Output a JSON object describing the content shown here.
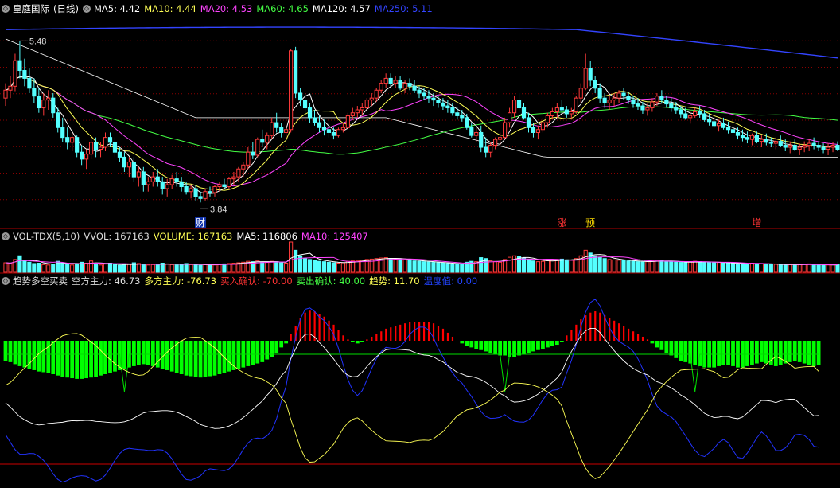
{
  "colors": {
    "up": "#ff3b3b",
    "down": "#54ffff",
    "ma5": "#ffffff",
    "ma10": "#ffff55",
    "ma20": "#ff44ff",
    "ma60": "#44ff44",
    "ma120": "#ffffff",
    "ma250": "#3344ff",
    "grid": "#8b0000",
    "green_bar": "#00ff00",
    "red_bar": "#ff0000",
    "blue_line": "#2233ff",
    "yellow_line": "#ffff55"
  },
  "main": {
    "stock_name": "皇庭国际",
    "period": "(日线)",
    "indicators": [
      {
        "label": "MA5: 4.42",
        "color": "#ffffff"
      },
      {
        "label": "MA10: 4.44",
        "color": "#ffff55"
      },
      {
        "label": "MA20: 4.53",
        "color": "#ff44ff"
      },
      {
        "label": "MA60: 4.65",
        "color": "#44ff44"
      },
      {
        "label": "MA120: 4.57",
        "color": "#ffffff"
      },
      {
        "label": "MA250: 5.11",
        "color": "#3344ff"
      }
    ],
    "high_label": "5.48",
    "low_label": "3.84",
    "event_marks": [
      {
        "text": "财",
        "index": 41,
        "color": "#ffffff",
        "bg": "#1133aa"
      },
      {
        "text": "涨",
        "index": 117,
        "color": "#ff3333",
        "bg": ""
      },
      {
        "text": "预",
        "index": 123,
        "color": "#ffdd00",
        "bg": ""
      },
      {
        "text": "增",
        "index": 158,
        "color": "#ff3333",
        "bg": ""
      }
    ]
  },
  "volume": {
    "title": "VOL-TDX(5,10)",
    "indicators": [
      {
        "label": "VVOL: 167163",
        "color": "#dddddd"
      },
      {
        "label": "VOLUME: 167163",
        "color": "#ffff55"
      },
      {
        "label": "MA5: 116806",
        "color": "#ffffff"
      },
      {
        "label": "MA10: 125407",
        "color": "#ff44ff"
      }
    ]
  },
  "trend": {
    "title": "趋势多空买卖",
    "indicators": [
      {
        "label": "空方主力: 46.73",
        "color": "#dddddd"
      },
      {
        "label": "多方主力: -76.73",
        "color": "#ffff55"
      },
      {
        "label": "买入确认: -70.00",
        "color": "#ff3333"
      },
      {
        "label": "卖出确认: 40.00",
        "color": "#44ff44"
      },
      {
        "label": "趋势: 11.70",
        "color": "#ffff55"
      },
      {
        "label": "温度值: 0.00",
        "color": "#2244ff"
      }
    ]
  },
  "chart_data": {
    "type": "candlestick",
    "series_count": 176,
    "price_range": [
      3.6,
      5.75
    ],
    "candles_ohlc": [
      [
        4.9,
        5.05,
        4.82,
        4.98
      ],
      [
        4.98,
        5.12,
        4.9,
        5.02
      ],
      [
        5.02,
        5.35,
        4.97,
        5.28
      ],
      [
        5.28,
        5.48,
        5.1,
        5.18
      ],
      [
        5.18,
        5.3,
        5.02,
        5.1
      ],
      [
        5.1,
        5.2,
        4.95,
        5.0
      ],
      [
        5.0,
        5.1,
        4.85,
        4.92
      ],
      [
        4.92,
        5.0,
        4.75,
        4.8
      ],
      [
        4.8,
        4.95,
        4.72,
        4.88
      ],
      [
        4.88,
        4.98,
        4.78,
        4.9
      ],
      [
        4.9,
        4.95,
        4.7,
        4.75
      ],
      [
        4.75,
        4.8,
        4.55,
        4.6
      ],
      [
        4.6,
        4.7,
        4.45,
        4.5
      ],
      [
        4.5,
        4.6,
        4.38,
        4.45
      ],
      [
        4.45,
        4.55,
        4.36,
        4.5
      ],
      [
        4.5,
        4.52,
        4.3,
        4.35
      ],
      [
        4.35,
        4.42,
        4.22,
        4.28
      ],
      [
        4.28,
        4.38,
        4.18,
        4.33
      ],
      [
        4.33,
        4.5,
        4.28,
        4.45
      ],
      [
        4.45,
        4.5,
        4.3,
        4.38
      ],
      [
        4.38,
        4.45,
        4.3,
        4.4
      ],
      [
        4.4,
        4.55,
        4.36,
        4.5
      ],
      [
        4.5,
        4.55,
        4.4,
        4.45
      ],
      [
        4.45,
        4.5,
        4.3,
        4.35
      ],
      [
        4.35,
        4.4,
        4.25,
        4.3
      ],
      [
        4.3,
        4.35,
        4.15,
        4.2
      ],
      [
        4.2,
        4.3,
        4.1,
        4.25
      ],
      [
        4.25,
        4.3,
        4.05,
        4.1
      ],
      [
        4.1,
        4.2,
        4.0,
        4.15
      ],
      [
        4.15,
        4.2,
        3.95,
        4.02
      ],
      [
        4.02,
        4.1,
        3.95,
        4.05
      ],
      [
        4.05,
        4.15,
        4.0,
        4.1
      ],
      [
        4.1,
        4.18,
        4.0,
        4.05
      ],
      [
        4.05,
        4.1,
        3.92,
        3.98
      ],
      [
        3.98,
        4.08,
        3.9,
        4.02
      ],
      [
        4.02,
        4.12,
        3.98,
        4.08
      ],
      [
        4.08,
        4.15,
        4.0,
        4.05
      ],
      [
        4.05,
        4.1,
        3.95,
        4.0
      ],
      [
        4.0,
        4.05,
        3.92,
        3.95
      ],
      [
        3.95,
        4.02,
        3.88,
        3.98
      ],
      [
        3.98,
        4.02,
        3.86,
        3.9
      ],
      [
        3.9,
        3.95,
        3.84,
        3.88
      ],
      [
        3.88,
        3.98,
        3.86,
        3.95
      ],
      [
        3.95,
        4.0,
        3.9,
        3.94
      ],
      [
        3.94,
        4.02,
        3.9,
        4.0
      ],
      [
        4.0,
        4.05,
        3.95,
        4.02
      ],
      [
        4.02,
        4.08,
        3.98,
        4.0
      ],
      [
        4.0,
        4.1,
        3.98,
        4.08
      ],
      [
        4.08,
        4.15,
        4.02,
        4.1
      ],
      [
        4.1,
        4.2,
        4.05,
        4.18
      ],
      [
        4.18,
        4.25,
        4.1,
        4.22
      ],
      [
        4.22,
        4.4,
        4.18,
        4.35
      ],
      [
        4.35,
        4.45,
        4.28,
        4.32
      ],
      [
        4.32,
        4.5,
        4.3,
        4.48
      ],
      [
        4.48,
        4.58,
        4.4,
        4.45
      ],
      [
        4.45,
        4.55,
        4.38,
        4.52
      ],
      [
        4.52,
        4.7,
        4.48,
        4.65
      ],
      [
        4.65,
        4.75,
        4.55,
        4.6
      ],
      [
        4.6,
        4.65,
        4.5,
        4.55
      ],
      [
        4.55,
        4.62,
        4.5,
        4.58
      ],
      [
        4.58,
        5.4,
        4.55,
        5.38
      ],
      [
        5.38,
        5.42,
        4.9,
        4.95
      ],
      [
        4.95,
        5.0,
        4.82,
        4.88
      ],
      [
        4.88,
        4.95,
        4.75,
        4.8
      ],
      [
        4.8,
        4.85,
        4.65,
        4.7
      ],
      [
        4.7,
        4.78,
        4.62,
        4.65
      ],
      [
        4.65,
        4.72,
        4.55,
        4.6
      ],
      [
        4.6,
        4.68,
        4.52,
        4.58
      ],
      [
        4.58,
        4.65,
        4.5,
        4.55
      ],
      [
        4.55,
        4.6,
        4.48,
        4.52
      ],
      [
        4.52,
        4.6,
        4.5,
        4.58
      ],
      [
        4.58,
        4.65,
        4.55,
        4.6
      ],
      [
        4.6,
        4.75,
        4.58,
        4.72
      ],
      [
        4.72,
        4.8,
        4.68,
        4.75
      ],
      [
        4.75,
        4.82,
        4.7,
        4.78
      ],
      [
        4.78,
        4.85,
        4.72,
        4.8
      ],
      [
        4.8,
        4.9,
        4.78,
        4.88
      ],
      [
        4.88,
        4.95,
        4.82,
        4.9
      ],
      [
        4.9,
        5.0,
        4.86,
        4.98
      ],
      [
        4.98,
        5.08,
        4.95,
        5.05
      ],
      [
        5.05,
        5.15,
        5.0,
        5.1
      ],
      [
        5.1,
        5.15,
        5.02,
        5.05
      ],
      [
        5.05,
        5.12,
        5.0,
        5.08
      ],
      [
        5.08,
        5.12,
        4.98,
        5.0
      ],
      [
        5.0,
        5.08,
        4.95,
        5.05
      ],
      [
        5.05,
        5.1,
        4.98,
        5.02
      ],
      [
        5.02,
        5.08,
        4.95,
        4.98
      ],
      [
        4.98,
        5.02,
        4.9,
        4.95
      ],
      [
        4.95,
        5.0,
        4.88,
        4.92
      ],
      [
        4.92,
        4.98,
        4.85,
        4.9
      ],
      [
        4.9,
        4.95,
        4.82,
        4.88
      ],
      [
        4.88,
        4.92,
        4.8,
        4.85
      ],
      [
        4.85,
        4.9,
        4.78,
        4.82
      ],
      [
        4.82,
        4.88,
        4.75,
        4.8
      ],
      [
        4.8,
        4.85,
        4.72,
        4.75
      ],
      [
        4.75,
        4.8,
        4.68,
        4.72
      ],
      [
        4.72,
        4.78,
        4.66,
        4.7
      ],
      [
        4.7,
        4.74,
        4.58,
        4.6
      ],
      [
        4.6,
        4.65,
        4.5,
        4.52
      ],
      [
        4.52,
        4.6,
        4.45,
        4.55
      ],
      [
        4.55,
        4.62,
        4.35,
        4.4
      ],
      [
        4.4,
        4.5,
        4.3,
        4.35
      ],
      [
        4.35,
        4.45,
        4.3,
        4.42
      ],
      [
        4.42,
        4.5,
        4.38,
        4.48
      ],
      [
        4.48,
        4.55,
        4.42,
        4.5
      ],
      [
        4.5,
        4.7,
        4.48,
        4.65
      ],
      [
        4.65,
        4.8,
        4.6,
        4.75
      ],
      [
        4.75,
        4.92,
        4.7,
        4.88
      ],
      [
        4.88,
        4.95,
        4.75,
        4.8
      ],
      [
        4.8,
        4.85,
        4.68,
        4.7
      ],
      [
        4.7,
        4.75,
        4.55,
        4.6
      ],
      [
        4.6,
        4.65,
        4.5,
        4.55
      ],
      [
        4.55,
        4.62,
        4.48,
        4.58
      ],
      [
        4.58,
        4.7,
        4.55,
        4.65
      ],
      [
        4.65,
        4.75,
        4.6,
        4.72
      ],
      [
        4.72,
        4.8,
        4.68,
        4.76
      ],
      [
        4.76,
        4.85,
        4.7,
        4.8
      ],
      [
        4.8,
        4.88,
        4.74,
        4.78
      ],
      [
        4.78,
        4.82,
        4.7,
        4.74
      ],
      [
        4.74,
        4.8,
        4.68,
        4.76
      ],
      [
        4.76,
        4.92,
        4.74,
        4.9
      ],
      [
        4.9,
        5.05,
        4.85,
        5.0
      ],
      [
        5.0,
        5.35,
        4.98,
        5.2
      ],
      [
        5.2,
        5.28,
        5.02,
        5.08
      ],
      [
        5.08,
        5.12,
        4.95,
        5.0
      ],
      [
        5.0,
        5.05,
        4.85,
        4.9
      ],
      [
        4.9,
        4.95,
        4.8,
        4.85
      ],
      [
        4.85,
        4.92,
        4.78,
        4.88
      ],
      [
        4.88,
        4.95,
        4.82,
        4.9
      ],
      [
        4.9,
        4.98,
        4.85,
        4.95
      ],
      [
        4.95,
        5.0,
        4.88,
        4.92
      ],
      [
        4.92,
        4.96,
        4.84,
        4.88
      ],
      [
        4.88,
        4.92,
        4.8,
        4.84
      ],
      [
        4.84,
        4.9,
        4.78,
        4.82
      ],
      [
        4.82,
        4.86,
        4.74,
        4.78
      ],
      [
        4.78,
        4.84,
        4.72,
        4.8
      ],
      [
        4.8,
        4.9,
        4.76,
        4.86
      ],
      [
        4.86,
        4.95,
        4.82,
        4.92
      ],
      [
        4.92,
        4.98,
        4.85,
        4.88
      ],
      [
        4.88,
        4.92,
        4.8,
        4.84
      ],
      [
        4.84,
        4.9,
        4.76,
        4.8
      ],
      [
        4.8,
        4.86,
        4.74,
        4.78
      ],
      [
        4.78,
        4.82,
        4.7,
        4.74
      ],
      [
        4.74,
        4.8,
        4.68,
        4.7
      ],
      [
        4.7,
        4.76,
        4.64,
        4.72
      ],
      [
        4.72,
        4.8,
        4.7,
        4.76
      ],
      [
        4.76,
        4.82,
        4.7,
        4.74
      ],
      [
        4.74,
        4.78,
        4.66,
        4.68
      ],
      [
        4.68,
        4.74,
        4.62,
        4.66
      ],
      [
        4.66,
        4.7,
        4.6,
        4.62
      ],
      [
        4.62,
        4.68,
        4.56,
        4.64
      ],
      [
        4.64,
        4.7,
        4.58,
        4.6
      ],
      [
        4.6,
        4.66,
        4.54,
        4.58
      ],
      [
        4.58,
        4.64,
        4.5,
        4.55
      ],
      [
        4.55,
        4.6,
        4.48,
        4.52
      ],
      [
        4.52,
        4.58,
        4.46,
        4.5
      ],
      [
        4.5,
        4.56,
        4.44,
        4.48
      ],
      [
        4.48,
        4.54,
        4.42,
        4.52
      ],
      [
        4.52,
        4.56,
        4.44,
        4.46
      ],
      [
        4.46,
        4.52,
        4.4,
        4.48
      ],
      [
        4.48,
        4.54,
        4.42,
        4.45
      ],
      [
        4.45,
        4.5,
        4.4,
        4.44
      ],
      [
        4.44,
        4.5,
        4.38,
        4.46
      ],
      [
        4.46,
        4.52,
        4.4,
        4.42
      ],
      [
        4.42,
        4.48,
        4.36,
        4.4
      ],
      [
        4.4,
        4.46,
        4.34,
        4.42
      ],
      [
        4.42,
        4.48,
        4.36,
        4.38
      ],
      [
        4.38,
        4.44,
        4.32,
        4.4
      ],
      [
        4.4,
        4.46,
        4.35,
        4.42
      ],
      [
        4.42,
        4.48,
        4.36,
        4.44
      ],
      [
        4.44,
        4.5,
        4.38,
        4.42
      ],
      [
        4.42,
        4.46,
        4.36,
        4.4
      ],
      [
        4.4,
        4.44,
        4.34,
        4.38
      ],
      [
        4.38,
        4.44,
        4.32,
        4.4
      ],
      [
        4.4,
        4.45,
        4.35,
        4.42
      ],
      [
        4.42,
        4.46,
        4.36,
        4.38
      ]
    ],
    "volume": [
      52,
      48,
      70,
      90,
      62,
      55,
      48,
      50,
      42,
      40,
      45,
      60,
      52,
      48,
      40,
      42,
      55,
      50,
      62,
      48,
      40,
      45,
      50,
      42,
      38,
      40,
      44,
      52,
      48,
      45,
      40,
      42,
      44,
      50,
      46,
      42,
      40,
      45,
      48,
      42,
      40,
      38,
      42,
      45,
      40,
      44,
      46,
      48,
      50,
      52,
      55,
      60,
      58,
      62,
      56,
      54,
      60,
      58,
      52,
      50,
      165,
      120,
      90,
      75,
      70,
      65,
      60,
      58,
      55,
      52,
      50,
      52,
      60,
      62,
      64,
      66,
      70,
      72,
      75,
      78,
      80,
      76,
      72,
      70,
      68,
      65,
      62,
      60,
      58,
      56,
      54,
      52,
      50,
      48,
      46,
      44,
      42,
      55,
      60,
      58,
      80,
      75,
      62,
      58,
      55,
      70,
      82,
      90,
      85,
      78,
      70,
      62,
      58,
      60,
      64,
      66,
      70,
      72,
      68,
      66,
      75,
      90,
      120,
      105,
      90,
      82,
      75,
      70,
      68,
      66,
      64,
      62,
      60,
      58,
      56,
      58,
      62,
      66,
      64,
      60,
      58,
      56,
      54,
      52,
      58,
      60,
      58,
      56,
      54,
      52,
      54,
      52,
      50,
      48,
      46,
      45,
      44,
      50,
      48,
      46,
      44,
      42,
      44,
      42,
      40,
      42,
      40,
      42,
      44,
      46,
      42,
      40,
      38,
      40,
      42,
      44
    ],
    "trend_bar": [
      -30,
      -32,
      -35,
      -38,
      -40,
      -42,
      -44,
      -46,
      -47,
      -48,
      -50,
      -52,
      -54,
      -55,
      -56,
      -57,
      -57,
      -56,
      -55,
      -54,
      -52,
      -50,
      -48,
      -46,
      -44,
      -42,
      -40,
      -38,
      -36,
      -35,
      -36,
      -38,
      -40,
      -42,
      -44,
      -46,
      -48,
      -50,
      -52,
      -53,
      -54,
      -55,
      -54,
      -53,
      -52,
      -50,
      -48,
      -46,
      -44,
      -42,
      -40,
      -38,
      -36,
      -34,
      -32,
      -28,
      -24,
      -18,
      -10,
      -4,
      10,
      22,
      34,
      42,
      45,
      44,
      40,
      36,
      30,
      24,
      16,
      8,
      2,
      -2,
      -4,
      -2,
      2,
      6,
      10,
      14,
      18,
      20,
      22,
      24,
      26,
      28,
      28,
      28,
      28,
      28,
      26,
      22,
      18,
      12,
      6,
      0,
      -4,
      -8,
      -10,
      -12,
      -14,
      -16,
      -18,
      -20,
      -22,
      -22,
      -24,
      -24,
      -22,
      -20,
      -18,
      -16,
      -14,
      -12,
      -10,
      -8,
      -6,
      -2,
      8,
      16,
      24,
      32,
      38,
      42,
      44,
      42,
      38,
      34,
      30,
      26,
      22,
      18,
      14,
      10,
      6,
      2,
      -4,
      -10,
      -14,
      -18,
      -22,
      -26,
      -30,
      -32,
      -34,
      -36,
      -38,
      -40,
      -40,
      -40,
      -38,
      -36,
      -36,
      -38,
      -40,
      -40,
      -38,
      -36,
      -34,
      -32,
      -34,
      -36,
      -38,
      -36,
      -34,
      -32,
      -30,
      -32,
      -34,
      -36,
      -38,
      -36
    ]
  }
}
